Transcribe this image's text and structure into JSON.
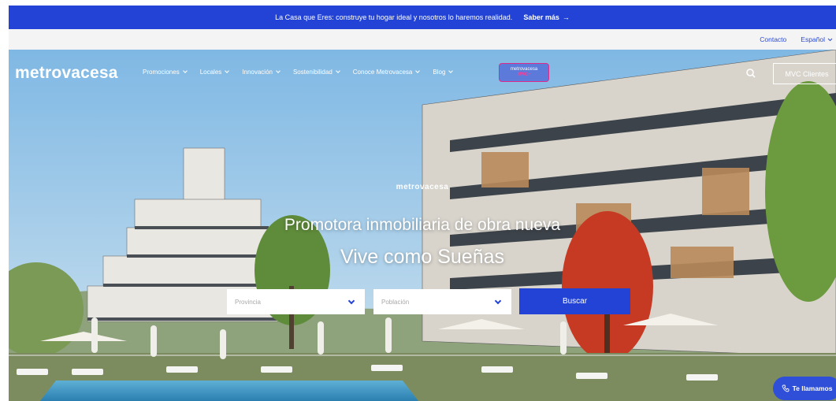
{
  "promo": {
    "text": "La Casa que Eres: construye tu hogar ideal y nosotros lo haremos realidad.",
    "cta": "Saber más",
    "cta_arrow": "→"
  },
  "utility": {
    "contact": "Contacto",
    "language": "Español"
  },
  "nav": {
    "logo": "metrovacesa",
    "items": [
      {
        "label": "Promociones"
      },
      {
        "label": "Locales"
      },
      {
        "label": "Innovación"
      },
      {
        "label": "Sostenibilidad"
      },
      {
        "label": "Conoce Metrovacesa"
      },
      {
        "label": "Blog"
      }
    ],
    "badge_top": "metrovacesa",
    "badge_bottom": "MVC+",
    "clients_button": "MVC Clientes"
  },
  "hero": {
    "brand_small": "metrovacesa",
    "headline": "Promotora inmobiliaria de obra nueva",
    "subheadline": "Vive como Sueñas"
  },
  "search": {
    "province_placeholder": "Provincia",
    "town_placeholder": "Población",
    "submit_label": "Buscar"
  },
  "call": {
    "label": "Te llamamos"
  },
  "colors": {
    "brand_blue": "#2243d6",
    "badge_pink": "#e02a8a"
  },
  "icons": {
    "search": "search-icon",
    "phone": "phone-icon"
  }
}
